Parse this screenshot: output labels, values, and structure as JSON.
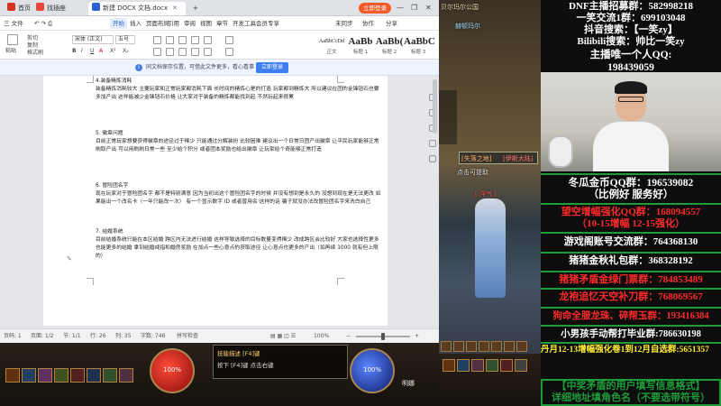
{
  "word": {
    "tabs": [
      {
        "label": "首页",
        "icon_color": "#d93025"
      },
      {
        "label": "找插座",
        "icon_color": "#e8453c"
      },
      {
        "label": "新建 DOCX 文档.docx",
        "icon_color": "#2b61d1"
      },
      {
        "label": "+"
      }
    ],
    "login_label": "立即登录",
    "menu": [
      "三 文件",
      "开始",
      "插入",
      "页面布局",
      "引用",
      "审阅",
      "视图",
      "章节",
      "开发工具",
      "会员专享"
    ],
    "menu_right": [
      "未同步",
      "协作",
      "分享"
    ],
    "ribbon": {
      "paste": "粘贴",
      "format_painter": "格式刷",
      "cut": "剪切",
      "copy": "复制",
      "font_name": "宋体 (正文)",
      "font_size": "五号",
      "styles": [
        {
          "preview": "AaBbCcDd",
          "name": "正文"
        },
        {
          "preview": "AaBb",
          "name": "标题 1"
        },
        {
          "preview": "AaBb(",
          "name": "标题 2"
        },
        {
          "preview": "AaBbC",
          "name": "标题 3"
        }
      ]
    },
    "notice": {
      "text": "同文档保存位置，可借此文件更多，看心看事",
      "button": "立即登录"
    },
    "document": {
      "paragraphs": [
        {
          "title": "4.装备精炼消耗",
          "body": "装备精炼消耗较大 主要玩家和正常玩家都消耗下面 长时间的精炼心是的打造 玩家都到精炼大 所以建议在团的金锋钮石也要多加产出 这样能减少金锋钮石价格 让大家对于装备的精炼都能找到起 不然玩起来很累"
        },
        {
          "title": "5. 徽章问题",
          "body": "目前正常玩家想要获得徽章的途径过于稀少 只能通过分解装扮 比较困难 建议出一个日常日团产出徽章 让平民玩家能够正常刷取产出 可以用刷刷日常一些 至少给个积分 或者团本奖励也给出徽章 让玩家给个奇能够正常打造"
        },
        {
          "title": "6. 冒险团名字",
          "body": "现在玩家对于冒险团名字 都不是特别满意 因为当初出这个冒险团名字的时候 并没有想到是永久的 没想到现在是无法更改 如果能出一个改名卡（一年只能改一次） 有一个显示数字 ID 或者曾用名 这样的话 骗子就没办法改冒险团名字来洗白自己"
        },
        {
          "title": "7. 结婚系统",
          "body": "目前结婚系统只能在本区结婚 跨区内无法进行结婚 这样导致选择的目标数量变得稀少 改成跨区会比较好 大家也选择性更多 也能更多的结婚 拿到结婚戒指和婚房奖励 在加点一些心意点的获取途径 让心意点也更多的产出（如再续 1000 就有但上限 的）"
        }
      ]
    },
    "status": {
      "page": "页码: 1",
      "pages": "页面: 1/2",
      "section": "节: 1/1",
      "row": "行: 26",
      "col": "列: 35",
      "words": "字数: 746",
      "spell": "拼写检查",
      "zoom": "100%"
    }
  },
  "game": {
    "top_label": "贝尔玛尔公国",
    "npc_label": "赫顿玛尔",
    "tag1": "[失落之地]",
    "tag2": "[伊斯大陆]",
    "prompt": "点击可提取",
    "player_label": "[ 洋气 ]",
    "skill_tip": "技能描述 [F4]键",
    "hp": "100%",
    "mp": "100%",
    "region": "明娜",
    "shortcut": "按下 [F4]键 点击右键"
  },
  "overlay": {
    "lines": [
      {
        "text": "DNF主播招募群：582998218",
        "color": "#ffffff"
      },
      {
        "text": "一笑交流1群：699103048",
        "color": "#ffffff"
      },
      {
        "text": "抖音搜索：【一笑zy】",
        "color": "#ffffff"
      },
      {
        "text": "Bilibili搜索：帅比一笑zy",
        "color": "#ffffff"
      },
      {
        "text": "主播唯一个人QQ:",
        "color": "#ffffff"
      },
      {
        "text": "198439059",
        "color": "#ffffff"
      }
    ],
    "list": [
      {
        "text": "冬瓜金币QQ群：196539082",
        "color": "#ffffff"
      },
      {
        "text": "（比例好 服务好）",
        "color": "#ffffff"
      },
      {
        "text": "望空增幅强化QQ群：168094557",
        "color": "#ff2b2b"
      },
      {
        "text": "（10-15增幅 12-15强化）",
        "color": "#ff2b2b"
      },
      {
        "text": "游戏阁账号交流群：764368130",
        "color": "#ffffff"
      },
      {
        "text": "猪猪金秋礼包群：368328192",
        "color": "#ffffff"
      },
      {
        "text": "猪猪矛盾金绿门票群：784853489",
        "color": "#ff2b2b"
      },
      {
        "text": "龙袍追忆天空补刀群：768069567",
        "color": "#ff2b2b"
      },
      {
        "text": "狗命全服龙珠、碎帮玉群：193416384",
        "color": "#ff2b2b"
      },
      {
        "text": "小男孩手动帮打毕业群:786630198",
        "color": "#ffffff"
      },
      {
        "text": "丹月12-13增幅强化卷1到12月自选群:5651357",
        "color": "#ffee33"
      }
    ],
    "footer1": "【中奖矛盾的用户填写信息格式】",
    "footer2": "详细地址填角色名（不要选带符号）",
    "footer_color": "#1f9c3a"
  }
}
